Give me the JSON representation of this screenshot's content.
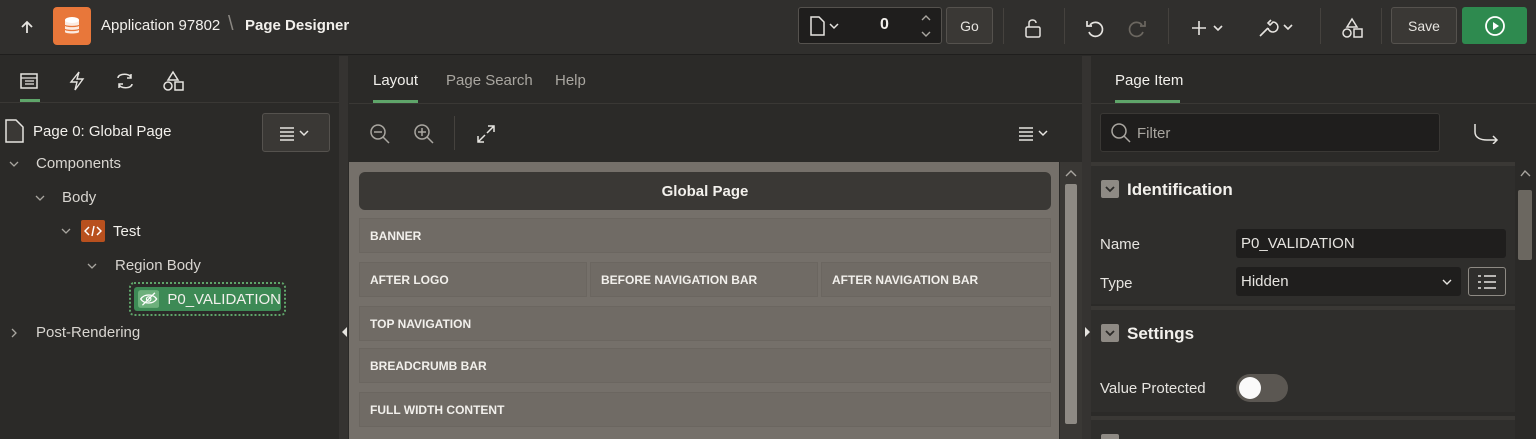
{
  "header": {
    "app_name": "Application 97802",
    "separator": "\\",
    "page_designer_title": "Page Designer",
    "page_number": "0",
    "go_label": "Go",
    "save_label": "Save"
  },
  "left_panel": {
    "tabs": [
      "rendering-icon",
      "dynamic-actions-icon",
      "processing-icon",
      "shared-components-icon"
    ],
    "page_title": "Page 0: Global Page",
    "tree": {
      "components": "Components",
      "body": "Body",
      "test": "Test",
      "region_body": "Region Body",
      "item": "P0_VALIDATION",
      "post_rendering": "Post-Rendering"
    }
  },
  "center": {
    "tabs": [
      "Layout",
      "Page Search",
      "Help"
    ],
    "global_page": "Global Page",
    "slots": {
      "banner": "BANNER",
      "after_logo": "AFTER LOGO",
      "before_nav": "BEFORE NAVIGATION BAR",
      "after_nav": "AFTER NAVIGATION BAR",
      "top_nav": "TOP NAVIGATION",
      "breadcrumb": "BREADCRUMB BAR",
      "full_width": "FULL WIDTH CONTENT"
    }
  },
  "right": {
    "tab": "Page Item",
    "filter_placeholder": "Filter",
    "identification": {
      "title": "Identification",
      "name_label": "Name",
      "name_value": "P0_VALIDATION",
      "type_label": "Type",
      "type_value": "Hidden"
    },
    "settings": {
      "title": "Settings",
      "value_protected_label": "Value Protected"
    }
  },
  "colors": {
    "accent_green": "#5fa56a",
    "run_green": "#2e8a4f",
    "app_orange": "#e8773a"
  }
}
